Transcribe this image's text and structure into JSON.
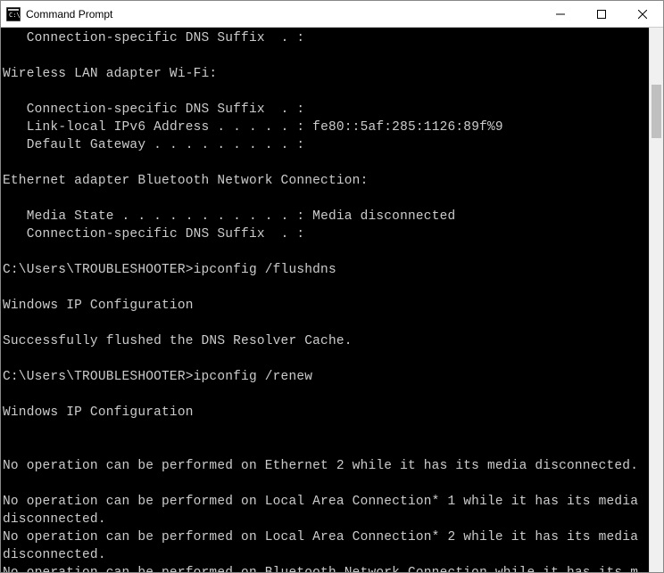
{
  "window": {
    "title": "Command Prompt"
  },
  "terminal": {
    "lines": [
      "   Connection-specific DNS Suffix  . :",
      "",
      "Wireless LAN adapter Wi-Fi:",
      "",
      "   Connection-specific DNS Suffix  . :",
      "   Link-local IPv6 Address . . . . . : fe80::5af:285:1126:89f%9",
      "   Default Gateway . . . . . . . . . :",
      "",
      "Ethernet adapter Bluetooth Network Connection:",
      "",
      "   Media State . . . . . . . . . . . : Media disconnected",
      "   Connection-specific DNS Suffix  . :",
      "",
      "C:\\Users\\TROUBLESHOOTER>ipconfig /flushdns",
      "",
      "Windows IP Configuration",
      "",
      "Successfully flushed the DNS Resolver Cache.",
      "",
      "C:\\Users\\TROUBLESHOOTER>ipconfig /renew",
      "",
      "Windows IP Configuration",
      "",
      "",
      "No operation can be performed on Ethernet 2 while it has its media disconnected.",
      "",
      "No operation can be performed on Local Area Connection* 1 while it has its media disconnected.",
      "No operation can be performed on Local Area Connection* 2 while it has its media disconnected.",
      "No operation can be performed on Bluetooth Network Connection while it has its m"
    ]
  }
}
